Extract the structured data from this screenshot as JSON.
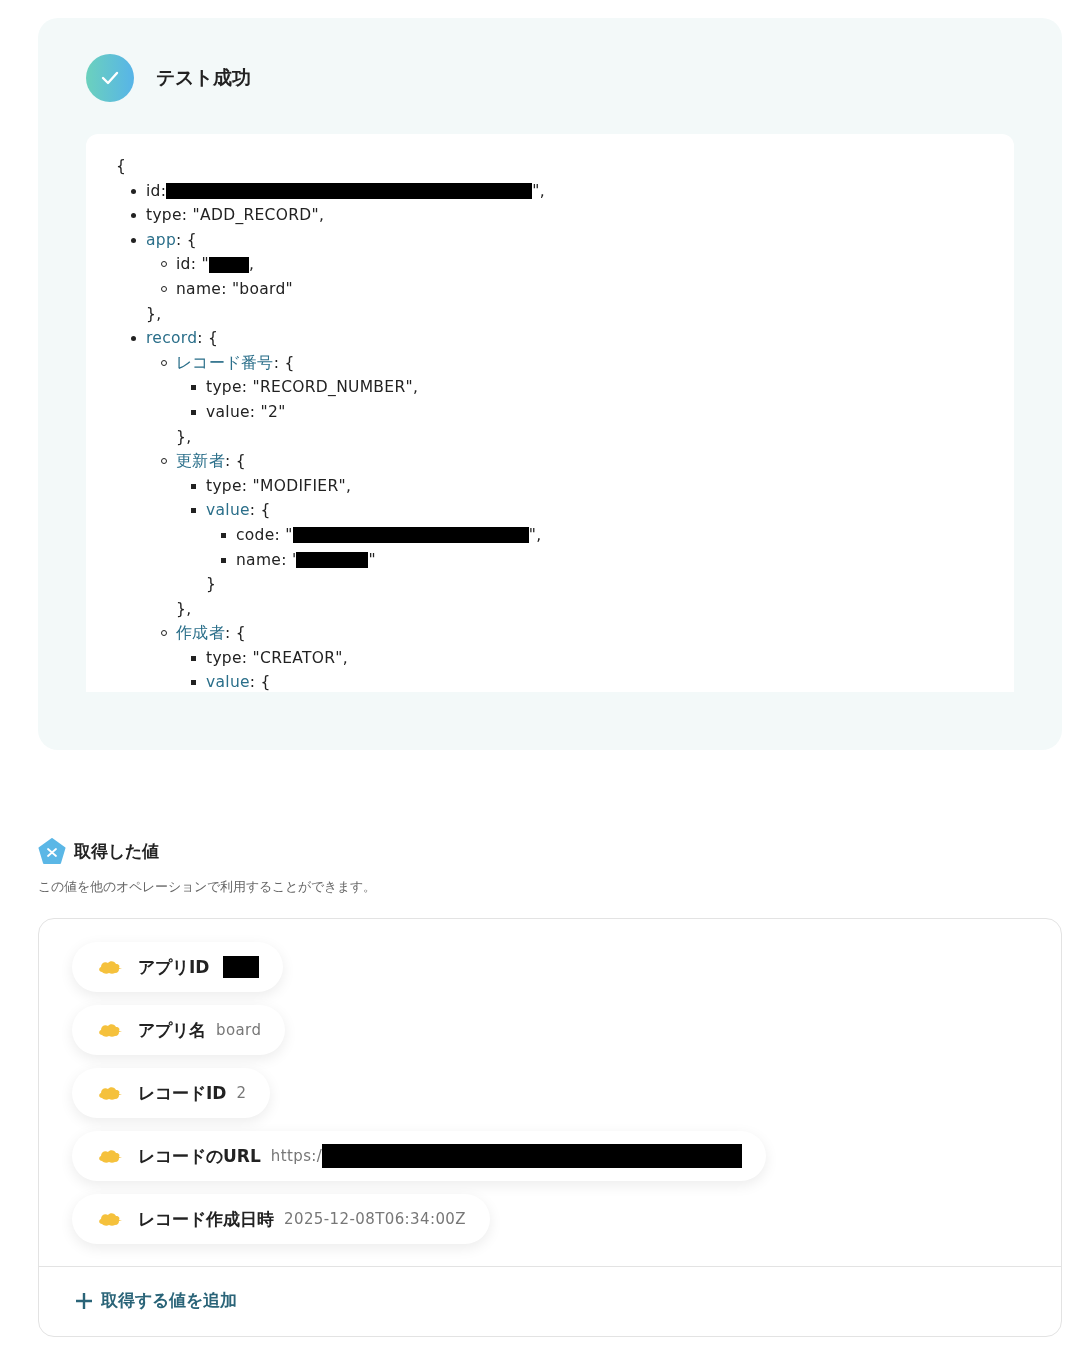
{
  "test_result": {
    "title": "テスト成功",
    "open": "{",
    "tree": [
      {
        "key": "id",
        "linked": false,
        "text": ": ",
        "redacted": true,
        "suffix": "\","
      },
      {
        "key": "type",
        "linked": false,
        "text": ": \"ADD_RECORD\","
      },
      {
        "key": "app",
        "linked": true,
        "text": ": {",
        "close": "},",
        "children": [
          {
            "key": "id",
            "linked": false,
            "text": ": \"",
            "redacted": true,
            "suffix": ","
          },
          {
            "key": "name",
            "linked": false,
            "text": ": \"board\""
          }
        ]
      },
      {
        "key": "record",
        "linked": true,
        "text": ": {",
        "children": [
          {
            "key": "レコード番号",
            "linked": true,
            "text": ": {",
            "close": "},",
            "children": [
              {
                "key": "type",
                "linked": false,
                "text": ": \"RECORD_NUMBER\","
              },
              {
                "key": "value",
                "linked": false,
                "text": ": \"2\""
              }
            ]
          },
          {
            "key": "更新者",
            "linked": true,
            "text": ": {",
            "close": "},",
            "children": [
              {
                "key": "type",
                "linked": false,
                "text": ": \"MODIFIER\","
              },
              {
                "key": "value",
                "linked": true,
                "text": ": {",
                "close": "}",
                "children": [
                  {
                    "key": "code",
                    "linked": false,
                    "text": ": \"",
                    "redacted": true,
                    "suffix": "\","
                  },
                  {
                    "key": "name",
                    "linked": false,
                    "text": ": '",
                    "redacted": true,
                    "suffix": "\""
                  }
                ]
              }
            ]
          },
          {
            "key": "作成者",
            "linked": true,
            "text": ": {",
            "children": [
              {
                "key": "type",
                "linked": false,
                "text": ": \"CREATOR\","
              },
              {
                "key": "value",
                "linked": true,
                "text": ": {"
              }
            ]
          }
        ]
      }
    ]
  },
  "values": {
    "title": "取得した値",
    "description": "この値を他のオペレーションで利用することができます。",
    "items": [
      {
        "label": "アプリID",
        "redacted": true
      },
      {
        "label": "アプリ名",
        "value": "board"
      },
      {
        "label": "レコードID",
        "value": "2"
      },
      {
        "label": "レコードのURL",
        "value": "https:/",
        "redacted": true
      },
      {
        "label": "レコード作成日時",
        "value": "2025-12-08T06:34:00Z"
      }
    ],
    "add_button": "取得する値を追加"
  }
}
